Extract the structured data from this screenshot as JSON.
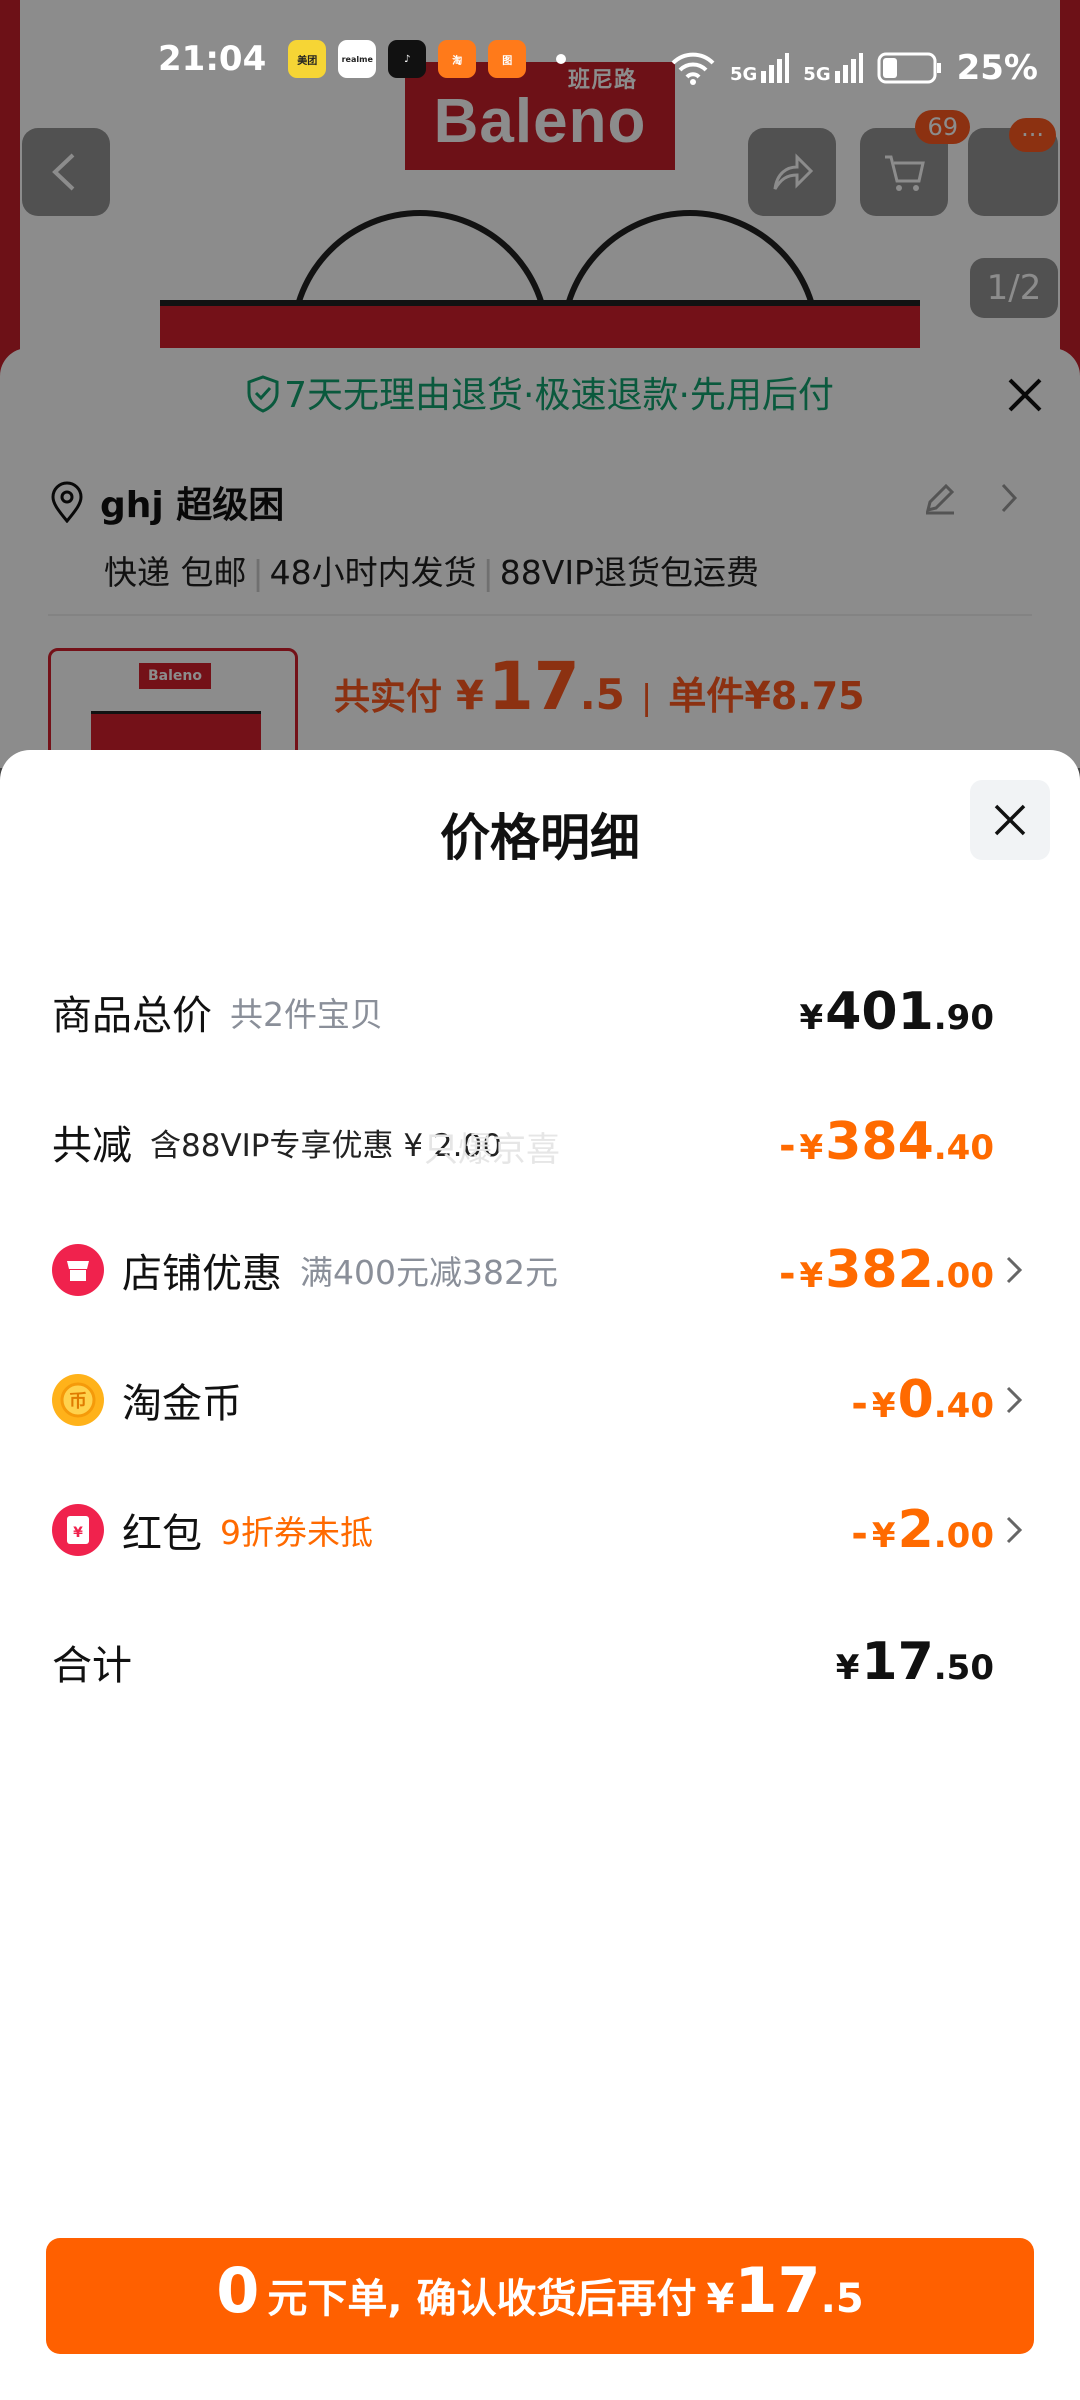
{
  "status_bar": {
    "time": "21:04",
    "net1": "5G",
    "net2": "5G",
    "battery": "25%",
    "app_icons": [
      "meituan-icon",
      "realme-icon",
      "douyin-icon",
      "taobao-icon",
      "app-icon"
    ]
  },
  "background_page": {
    "brand_logo": "Baleno",
    "brand_logo_cn": "班尼路",
    "cart_count": "69",
    "more_label": "···",
    "image_index": "1/2",
    "promise": "7天无理由退货·极速退款·先用后付",
    "address_name": "ghj 超级困",
    "shipping": [
      "快递 包邮",
      "48小时内发货",
      "88VIP退货包运费"
    ],
    "total_label": "共实付",
    "total_currency": "¥",
    "total_int": "17",
    "total_dec": ".5",
    "unit_label": "单件¥8.75"
  },
  "sheet": {
    "title": "价格明细",
    "watermark": "只爆京喜",
    "rows": [
      {
        "label": "商品总价",
        "sub": "共2件宝贝",
        "currency": "¥",
        "int": "401",
        "dec": ".90"
      },
      {
        "label": "共减",
        "sub": "含88VIP专享优惠 ¥ 2.00",
        "minus": "-",
        "currency": "¥",
        "int": "384",
        "dec": ".40"
      },
      {
        "label": "店铺优惠",
        "sub": "满400元减382元",
        "minus": "-",
        "currency": "¥",
        "int": "382",
        "dec": ".00"
      },
      {
        "label": "淘金币",
        "sub": "",
        "minus": "-",
        "currency": "¥",
        "int": "0",
        "dec": ".40"
      },
      {
        "label": "红包",
        "sub": "9折券未抵",
        "minus": "-",
        "currency": "¥",
        "int": "2",
        "dec": ".00"
      },
      {
        "label": "合计",
        "sub": "",
        "currency": "¥",
        "int": "17",
        "dec": ".50"
      }
    ]
  },
  "cta": {
    "zero": "0",
    "text": "元下单, 确认收货后再付",
    "currency": "¥",
    "int": "17",
    "dec": ".5"
  },
  "colors": {
    "accent_orange": "#ff6000",
    "promise_green": "#13a36f",
    "brand_red": "#d31f2c"
  }
}
